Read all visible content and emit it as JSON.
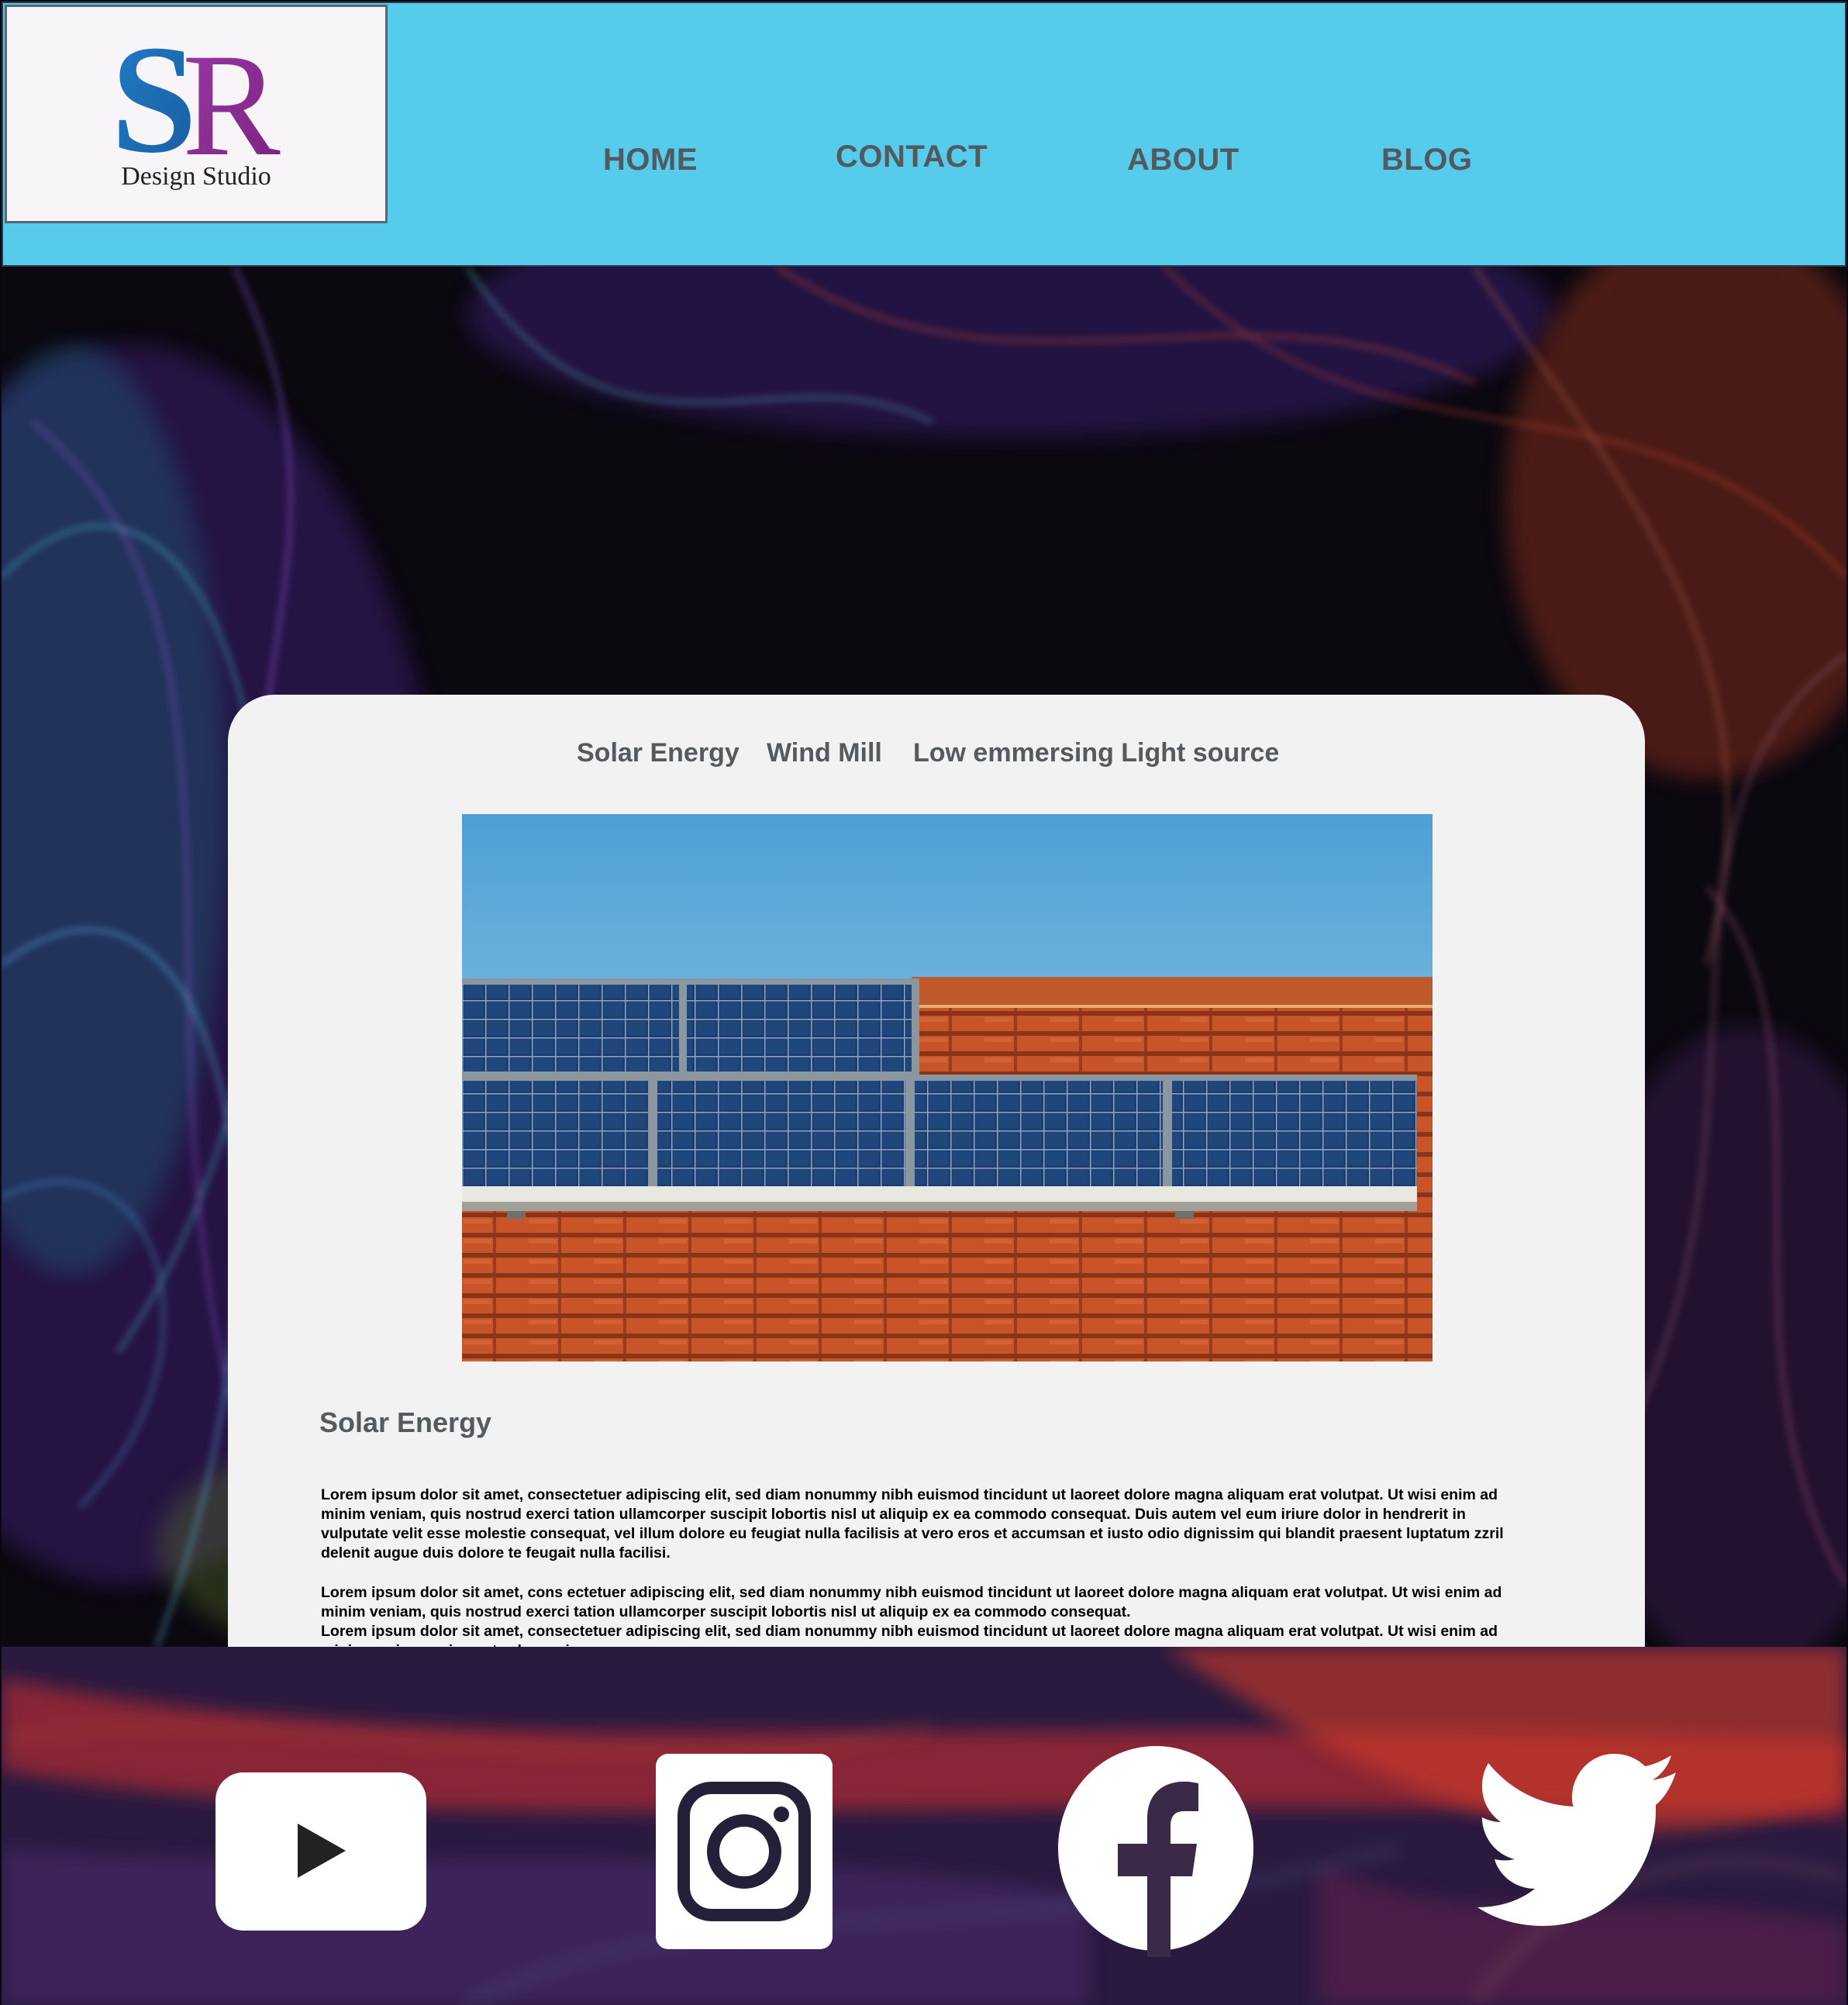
{
  "logo": {
    "monogram": "SR",
    "subtitle": "Design Studio"
  },
  "nav": {
    "items": [
      "HOME",
      "CONTACT",
      "ABOUT",
      "BLOG"
    ]
  },
  "content": {
    "tabs": [
      "Solar Energy",
      "Wind Mill",
      "Low emmersing Light source"
    ],
    "section_title": "Solar Energy",
    "paragraphs": [
      "Lorem ipsum dolor sit amet, consectetuer adipiscing elit, sed diam nonummy nibh euismod tincidunt ut laoreet dolore magna aliquam erat volutpat. Ut wisi enim ad minim veniam, quis nostrud exerci tation ullamcorper suscipit lobortis nisl ut aliquip ex ea commodo consequat. Duis autem vel eum iriure dolor in hendrerit in vulputate velit esse molestie consequat, vel illum dolore eu feugiat nulla facilisis at vero eros et accumsan et iusto odio dignissim qui blandit praesent luptatum zzril delenit augue duis dolore te feugait nulla facilisi.",
      "Lorem ipsum dolor sit amet, cons ectetuer adipiscing elit, sed diam nonummy nibh euismod tincidunt ut laoreet dolore magna aliquam erat volutpat. Ut wisi enim ad minim veniam, quis nostrud exerci tation ullamcorper suscipit lobortis nisl ut aliquip ex ea commodo consequat.",
      "Lorem ipsum dolor sit amet, consectetuer adipiscing elit, sed diam nonummy nibh euismod tincidunt ut laoreet dolore magna aliquam erat volutpat. Ut wisi enim ad minim veniam, quis nostrud exerci"
    ]
  },
  "social": {
    "icons": [
      "youtube-icon",
      "instagram-icon",
      "facebook-icon",
      "twitter-icon"
    ]
  },
  "colors": {
    "header_bg": "#56cbec",
    "nav_text": "#525a60",
    "card_bg": "#f2f2f2",
    "logo_blue": "#1f6fb8",
    "logo_purple": "#8a2c92"
  }
}
